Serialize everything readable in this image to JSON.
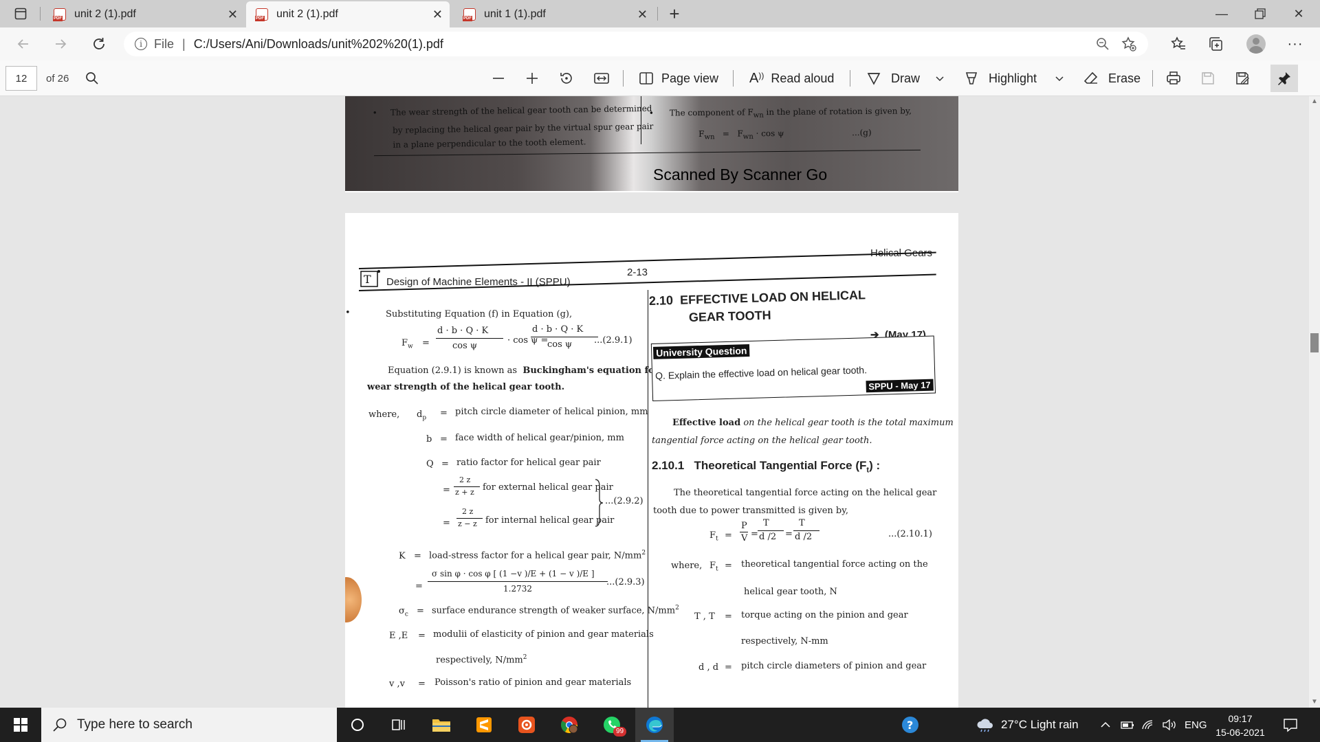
{
  "tabs": [
    {
      "title": "unit 2 (1).pdf",
      "active": false
    },
    {
      "title": "unit 2 (1).pdf",
      "active": true
    },
    {
      "title": "unit 1 (1).pdf",
      "active": false
    }
  ],
  "address": {
    "file_label": "File",
    "separator": "|",
    "url": "C:/Users/Ani/Downloads/unit%202%20(1).pdf"
  },
  "pdf_toolbar": {
    "page_number": "12",
    "page_total": "of 26",
    "page_view": "Page view",
    "read_aloud": "Read aloud",
    "draw": "Draw",
    "highlight": "Highlight",
    "erase": "Erase"
  },
  "page1": {
    "left_text_1": "The wear strength of the helical gear tooth can be determined",
    "left_text_2": "by replacing the helical gear pair by the virtual spur gear pair",
    "left_text_3": "in a plane perpendicular to the tooth element.",
    "right_text_1": "The component of F",
    "right_text_1b": "wn",
    "right_text_1c": " in the plane of rotation is given by,",
    "right_formula": "F",
    "right_formula_sub": "wn",
    "right_formula_eq": "=",
    "right_formula_rhs": "F",
    "right_formula_rhs_sub": "wn",
    "right_formula_rest": " · cos ψ",
    "right_eq_num": "...(g)",
    "footer": "Scanned By Scanner Go"
  },
  "page2": {
    "header_right": "Helical Gears",
    "header_left": "Design of Machine Elements - II (SPPU)",
    "page_no": "2-13",
    "sub_eq_g": "Substituting Equation (f) in Equation (g),",
    "fw_lhs": "F",
    "fw_lhs_sub": "w",
    "fw_eq": "=",
    "fw_frac1_num": "d  · b · Q · K",
    "fw_frac1_den": "cos ψ",
    "fw_mid": "· cos ψ =",
    "fw_frac2_num": "d  · b · Q · K",
    "fw_frac2_den": "cos ψ",
    "fw_eqnum": "...(2.9.1)",
    "buck_1": "Equation (2.9.1) is known as",
    "buck_bold": "Buckingham's equation for",
    "buck_2": "wear strength of the helical gear tooth.",
    "where": "where,",
    "dp_sym": "d",
    "dp_eq": "=",
    "dp_text": "pitch circle diameter of helical pinion, mm",
    "b_sym": "b",
    "b_eq": "=",
    "b_text": "face width of helical gear/pinion, mm",
    "q_sym": "Q",
    "q_eq": "=",
    "q_text": "ratio factor for helical gear pair",
    "q1_eq": "=",
    "q1_num": "2 z",
    "q1_den": "z  + z",
    "q1_text": "for external helical gear pair",
    "q2_eq": "=",
    "q2_num": "2 z",
    "q2_den": "z  − z",
    "q2_text": "for internal helical gear pair",
    "q_eqnum": "...(2.9.2)",
    "k_sym": "K",
    "k_eq": "=",
    "k_text": "load-stress factor for a helical gear pair, N/mm",
    "k2_eq": "=",
    "k2_num": "σ  sin φ  · cos φ  [ (1 −v )/E  + (1 − v )/E  ]",
    "k2_den": "1.2732",
    "k_eqnum": "...(2.9.3)",
    "sc_sym": "σ",
    "sc_eq": "=",
    "sc_text": "surface endurance strength of weaker surface, N/mm",
    "e_sym": "E ,E",
    "e_eq": "=",
    "e_text": "modulii of elasticity of pinion and gear materials",
    "e_text2": "respectively, N/mm",
    "v_sym": "v ,v",
    "v_eq": "=",
    "v_text": "Poisson's ratio of pinion and gear materials",
    "sec_num": "2.10",
    "sec_title_1": "EFFECTIVE  LOAD  ON  HELICAL",
    "sec_title_2": "GEAR TOOTH",
    "may17": "(May 17)",
    "uq_label": "University Question",
    "uq_q": "Q.  Explain the effective load on helical gear tooth.",
    "uq_tag": "SPPU - May 17",
    "eff_1_bold": "Effective load",
    "eff_1": "on the helical gear tooth is the total maximum",
    "eff_2": "tangential force acting on the helical gear tooth.",
    "sub_num": "2.10.1",
    "sub_title": "Theoretical Tangential Force (F",
    "sub_title_sub": "t",
    "sub_title_end": ") :",
    "ttf_1": "The theoretical tangential force acting on the helical gear",
    "ttf_2": "tooth due to power transmitted is given by,",
    "ft_lhs": "F",
    "ft_lhs_sub": "t",
    "ft_eq": "=",
    "ft_f1_num": "P",
    "ft_f1_den": "V",
    "ft_f2_num": "T",
    "ft_f2_den": "d /2",
    "ft_f3_num": "T",
    "ft_f3_den": "d /2",
    "ft_eqnum": "...(2.10.1)",
    "w_where": "where,",
    "w_ft": "F",
    "w_ft_eq": "=",
    "w_ft_text": "theoretical tangential force acting on the",
    "w_ft_text2": "helical gear tooth, N",
    "w_t_sym": "T , T",
    "w_t_eq": "=",
    "w_t_text": "torque acting on the pinion and gear",
    "w_t_text2": "respectively, N-mm",
    "w_d_sym": "d , d",
    "w_d_eq": "=",
    "w_d_text": "pitch circle diameters of pinion and gear"
  },
  "taskbar": {
    "search_placeholder": "Type here to search",
    "whatsapp_badge": "99",
    "weather": "27°C  Light rain",
    "lang": "ENG",
    "time": "09:17",
    "date": "15-06-2021"
  },
  "colors": {
    "tabstrip": "#cfcfcf",
    "active_tab": "#f7f7f7",
    "pdf_red": "#c5372a",
    "taskbar": "#1f1f1f",
    "taskbar_active_indicator": "#76b9ed"
  }
}
